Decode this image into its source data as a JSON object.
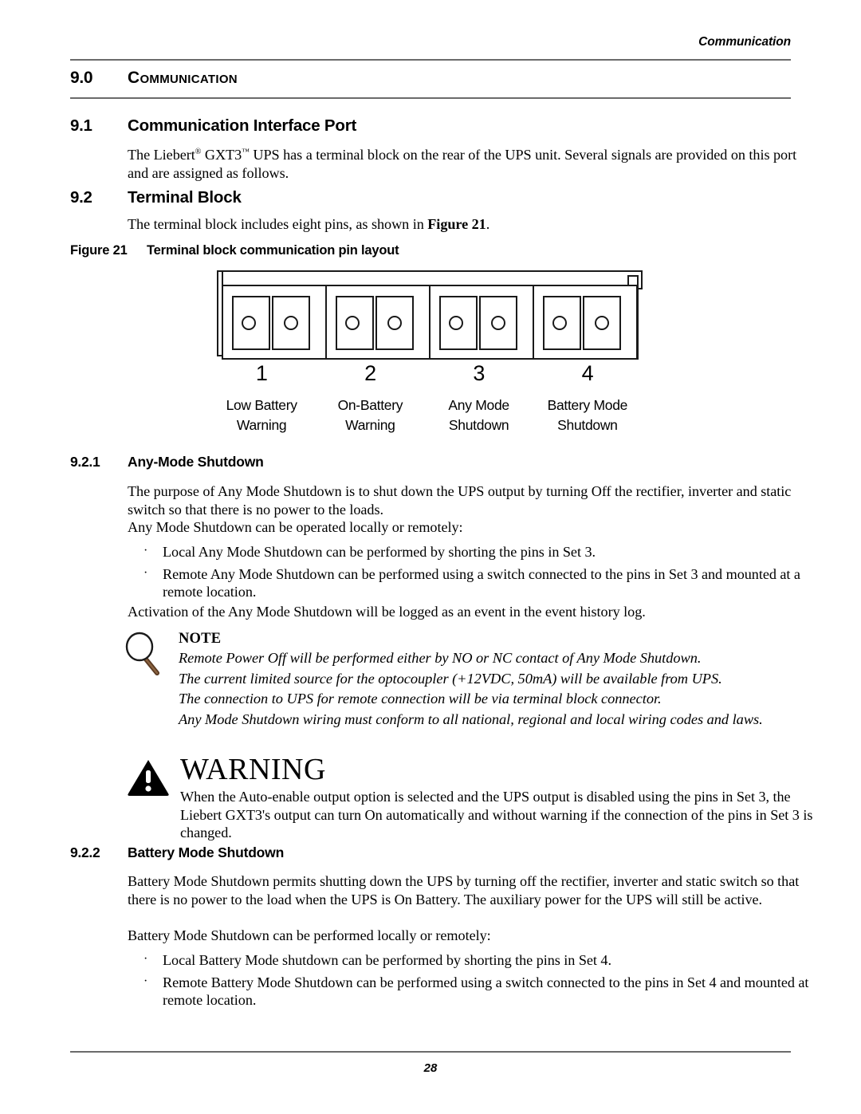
{
  "header": {
    "running_title": "Communication"
  },
  "chapter": {
    "number": "9.0",
    "title": "Communication"
  },
  "sections": {
    "s91": {
      "number": "9.1",
      "title": "Communication Interface Port",
      "paragraph_prefix": "The Liebert",
      "reg_mark": "®",
      "paragraph_mid": " GXT3",
      "tm_mark": "™",
      "paragraph_rest": " UPS has a terminal block on the rear of the UPS unit. Several signals are provided on this port and are assigned as follows."
    },
    "s92": {
      "number": "9.2",
      "title": "Terminal Block",
      "paragraph_a": "The terminal block includes eight pins, as shown in ",
      "paragraph_b": "Figure 21",
      "paragraph_c": "."
    },
    "s921": {
      "number": "9.2.1",
      "title": "Any-Mode Shutdown",
      "p1": "The purpose of Any Mode Shutdown is to shut down the UPS output by turning Off the rectifier, inverter and static switch so that there is no power to the loads.",
      "p2": "Any Mode Shutdown can be operated locally or remotely:",
      "bullets": [
        "Local Any Mode Shutdown can be performed by shorting the pins in Set 3.",
        "Remote Any Mode Shutdown can be performed using a switch connected to the pins in Set 3 and mounted at a remote location."
      ],
      "p3": "Activation of the Any Mode Shutdown will be logged as an event in the event history log."
    },
    "s922": {
      "number": "9.2.2",
      "title": "Battery Mode Shutdown",
      "p1": "Battery Mode Shutdown permits shutting down the UPS by turning off the rectifier, inverter and static switch so that there is no power to the load when the UPS is On Battery. The auxiliary power for the UPS will still be active.",
      "p2": "Battery Mode Shutdown can be performed locally or remotely:",
      "bullets": [
        "Local Battery Mode shutdown can be performed by shorting the pins in Set 4.",
        "Remote Battery Mode Shutdown can be performed using a switch connected to the pins in Set 4 and mounted at remote location."
      ]
    }
  },
  "figure": {
    "caption_number": "Figure 21",
    "caption_title": "Terminal block communication pin layout",
    "pin_sets": [
      {
        "number": "1",
        "label_line1": "Low Battery",
        "label_line2": "Warning"
      },
      {
        "number": "2",
        "label_line1": "On-Battery",
        "label_line2": "Warning"
      },
      {
        "number": "3",
        "label_line1": "Any Mode",
        "label_line2": "Shutdown"
      },
      {
        "number": "4",
        "label_line1": "Battery Mode",
        "label_line2": "Shutdown"
      }
    ]
  },
  "note": {
    "icon": "magnifier-icon",
    "title": "NOTE",
    "lines": [
      "Remote Power Off will be performed either by NO or NC contact of Any Mode Shutdown.",
      "The current limited source for the optocoupler (+12VDC, 50mA) will be available from UPS.",
      "The connection to UPS for remote connection will be via terminal block connector.",
      "Any Mode Shutdown wiring must conform to all national, regional and local wiring codes and laws."
    ]
  },
  "warning": {
    "icon": "warning-triangle-icon",
    "title": "WARNING",
    "text": "When the Auto-enable output option is selected and the UPS output is disabled using the pins in Set 3, the Liebert GXT3's output can turn On automatically and without warning if the connection of the pins in Set 3 is changed."
  },
  "footer": {
    "page_number": "28"
  },
  "colors": {
    "rule": "#6b6b6b",
    "text": "#000000",
    "magnifier_handle": "#5a3a22"
  }
}
